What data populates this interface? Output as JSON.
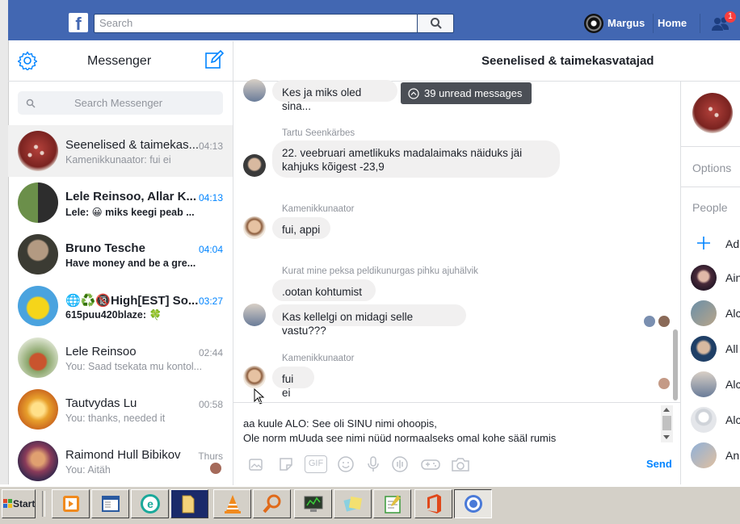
{
  "fb": {
    "logo": "f",
    "search_placeholder": "Search",
    "user": "Margus",
    "home": "Home",
    "notifications": "1"
  },
  "messenger": {
    "title": "Messenger",
    "search_placeholder": "Search Messenger"
  },
  "conversations": [
    {
      "name": "Seenelised & taimekas...",
      "preview": "Kamenikkunaator: fui ei",
      "time": "04:13",
      "unread": false,
      "active": true
    },
    {
      "name": "Lele Reinsoo, Allar K...",
      "preview": "Lele: 😀 miks keegi peab ...",
      "time": "04:13",
      "unread": true
    },
    {
      "name": "Bruno Tesche",
      "preview": "Have money and be a gre...",
      "time": "04:04",
      "unread": true
    },
    {
      "name": "🌐♻️🔞High[EST] So...",
      "preview": "615puu420blaze: 🍀",
      "time": "03:27",
      "unread": true
    },
    {
      "name": "Lele Reinsoo",
      "preview": "You: Saad tsekata mu kontol...",
      "time": "02:44",
      "unread": false
    },
    {
      "name": "Tautvydas Lu",
      "preview": "You: thanks, needed it",
      "time": "00:58",
      "unread": false
    },
    {
      "name": "Raimond Hull Bibikov",
      "preview": "You: Aitäh",
      "time": "Thurs",
      "unread": false
    }
  ],
  "conversation": {
    "title": "Seenelised & taimekasvatajad",
    "unread_banner": "39 unread messages",
    "messages": [
      {
        "text": "Kes ja miks oled sina..."
      },
      {
        "sender": "Tartu Seenkärbes",
        "text_line1": "22. veebruari ametlikuks madalaimaks näiduks jäi",
        "text_line2": "kahjuks kõigest -23,9"
      },
      {
        "sender": "Kamenikkunaator",
        "text": "fui, appi"
      },
      {
        "sender": "Kurat mine peksa peldikunurgas pihku ajuhälvik",
        "text": ".ootan kohtumist"
      },
      {
        "text": "Kas kellelgi on midagi selle vastu???"
      },
      {
        "sender": "Kamenikkunaator",
        "text": "fui ei"
      }
    ],
    "draft_line1": "aa kuule ALO: See oli SINU nimi ohoopis,",
    "draft_line2": "Ole norm mUuda see nimi nüüd normaalseks omal kohe sääl rumis",
    "send": "Send",
    "tools": [
      "photo-icon",
      "sticker-icon",
      "gif-icon",
      "emoji-icon",
      "microphone-icon",
      "audio-icon",
      "game-icon",
      "camera-icon"
    ],
    "gif_label": "GIF"
  },
  "right_panel": {
    "options": "Options",
    "people": "People",
    "add": "Ad",
    "people_list": [
      "Ain",
      "Alc",
      "All",
      "Alc",
      "Alc",
      "An"
    ]
  },
  "taskbar": {
    "start": "Start"
  },
  "colors": {
    "fb_blue": "#4267b2",
    "messenger_blue": "#0084ff",
    "bubble_gray": "#f1f0f0"
  }
}
